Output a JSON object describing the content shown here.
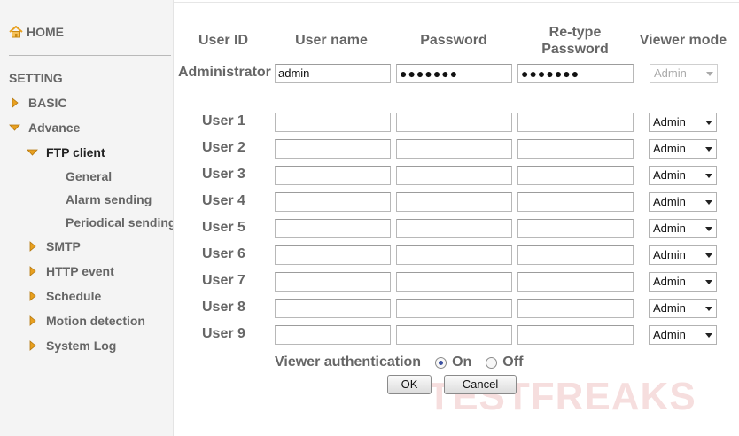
{
  "sidebar": {
    "home_label": "HOME",
    "setting_label": "SETTING",
    "items": [
      {
        "label": "BASIC"
      },
      {
        "label": "Advance"
      },
      {
        "label": "FTP client"
      },
      {
        "label": "General"
      },
      {
        "label": "Alarm sending"
      },
      {
        "label": "Periodical sending"
      },
      {
        "label": "SMTP"
      },
      {
        "label": "HTTP event"
      },
      {
        "label": "Schedule"
      },
      {
        "label": "Motion detection"
      },
      {
        "label": "System Log"
      }
    ]
  },
  "table": {
    "headers": {
      "user_id": "User ID",
      "user_name": "User name",
      "password": "Password",
      "retype_line1": "Re-type",
      "retype_line2": "Password",
      "viewer_mode": "Viewer mode"
    },
    "admin": {
      "label": "Administrator",
      "user_name": "admin",
      "password": "●●●●●●●",
      "retype": "●●●●●●●",
      "mode": "Admin"
    },
    "users": [
      {
        "label": "User 1",
        "mode": "Admin"
      },
      {
        "label": "User 2",
        "mode": "Admin"
      },
      {
        "label": "User 3",
        "mode": "Admin"
      },
      {
        "label": "User 4",
        "mode": "Admin"
      },
      {
        "label": "User 5",
        "mode": "Admin"
      },
      {
        "label": "User 6",
        "mode": "Admin"
      },
      {
        "label": "User 7",
        "mode": "Admin"
      },
      {
        "label": "User 8",
        "mode": "Admin"
      },
      {
        "label": "User 9",
        "mode": "Admin"
      }
    ]
  },
  "viewer_auth": {
    "label": "Viewer authentication",
    "on_label": "On",
    "off_label": "Off",
    "selected": "On"
  },
  "buttons": {
    "ok": "OK",
    "cancel": "Cancel"
  },
  "watermark": {
    "text": "TESTFREAKS"
  },
  "colors": {
    "accent_orange": "#e8a020",
    "watermark": "#f0c2c2",
    "radio_dot": "#3a4fa0"
  }
}
